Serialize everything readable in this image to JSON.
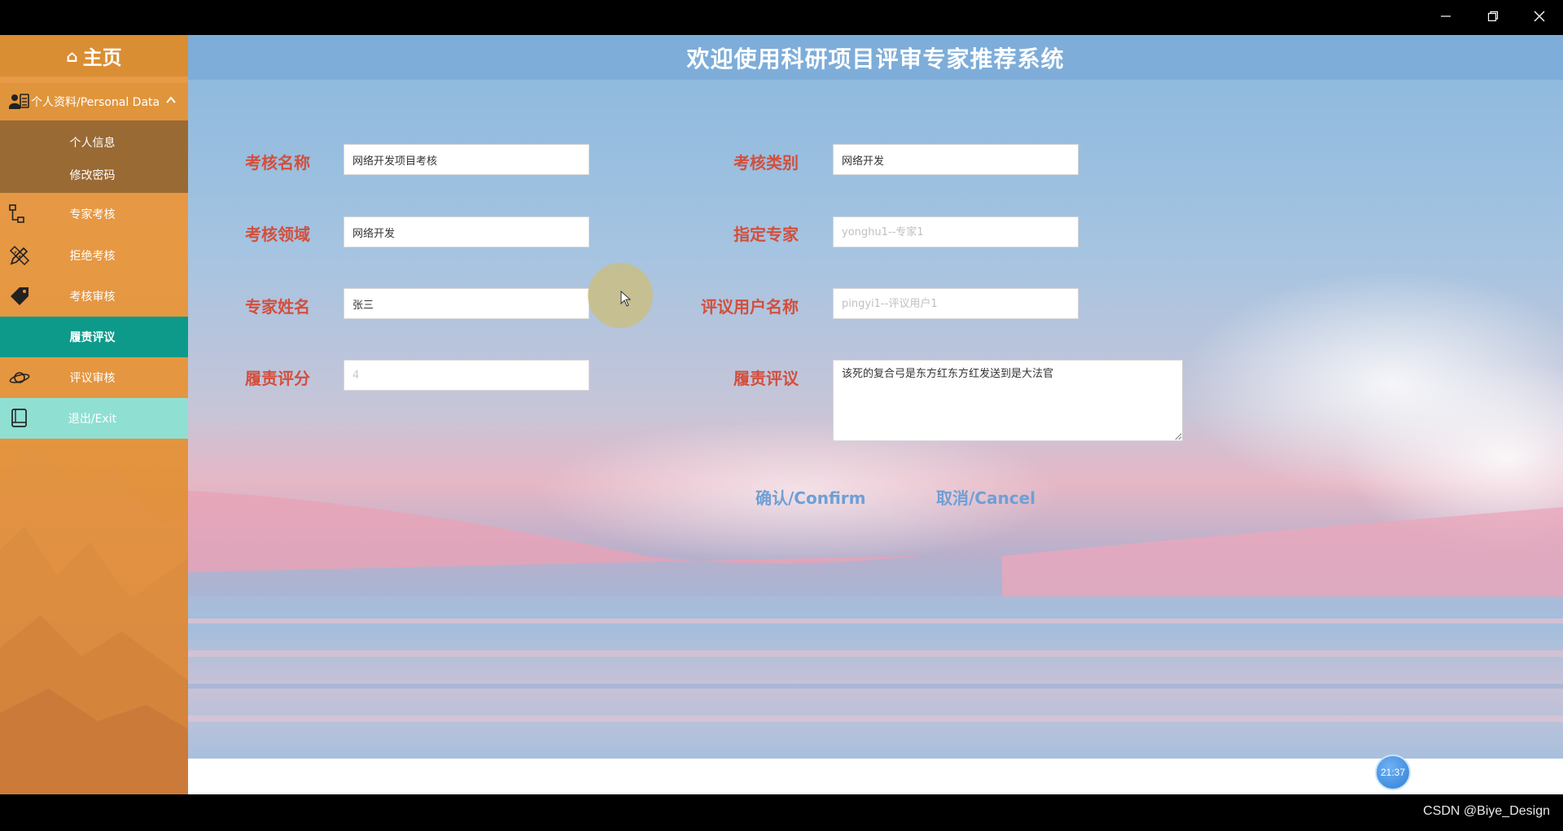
{
  "sidebar": {
    "home_label": "主页",
    "group": {
      "label": "个人资料/Personal Data"
    },
    "sub_items": [
      {
        "label": "个人信息"
      },
      {
        "label": "修改密码"
      }
    ],
    "items": [
      {
        "label": "专家考核",
        "icon": "hierarchy-icon"
      },
      {
        "label": "拒绝考核",
        "icon": "pencil-ruler-icon"
      },
      {
        "label": "考核审核",
        "icon": "tag-icon"
      },
      {
        "label": "履责评议",
        "active": true
      },
      {
        "label": "评议审核",
        "icon": "planet-icon"
      },
      {
        "label": "退出/Exit",
        "icon": "book-icon"
      }
    ]
  },
  "header": {
    "title": "欢迎使用科研项目评审专家推荐系统"
  },
  "form": {
    "assessment_name": {
      "label": "考核名称",
      "value": "网络开发项目考核"
    },
    "assessment_category": {
      "label": "考核类别",
      "value": "网络开发"
    },
    "assessment_field": {
      "label": "考核领域",
      "value": "网络开发"
    },
    "assigned_expert": {
      "label": "指定专家",
      "placeholder": "yonghu1--专家1"
    },
    "expert_name": {
      "label": "专家姓名",
      "value": "张三"
    },
    "reviewer_username": {
      "label": "评议用户名称",
      "placeholder": "pingyi1--评议用户1"
    },
    "duty_score": {
      "label": "履责评分",
      "placeholder": "4"
    },
    "duty_review": {
      "label": "履责评议",
      "value": "该死的复合弓是东方红东方红发送到是大法官"
    }
  },
  "actions": {
    "confirm": "确认/Confirm",
    "cancel": "取消/Cancel"
  },
  "clock": "21:37",
  "watermark": "CSDN @Biye_Design",
  "colors": {
    "sidebar": "#e5963f",
    "active_item": "#0d9a8a",
    "exit_item": "#8fe0d2",
    "header": "#7eadd9",
    "label": "#d24f3c",
    "button": "#6f9fd4"
  }
}
